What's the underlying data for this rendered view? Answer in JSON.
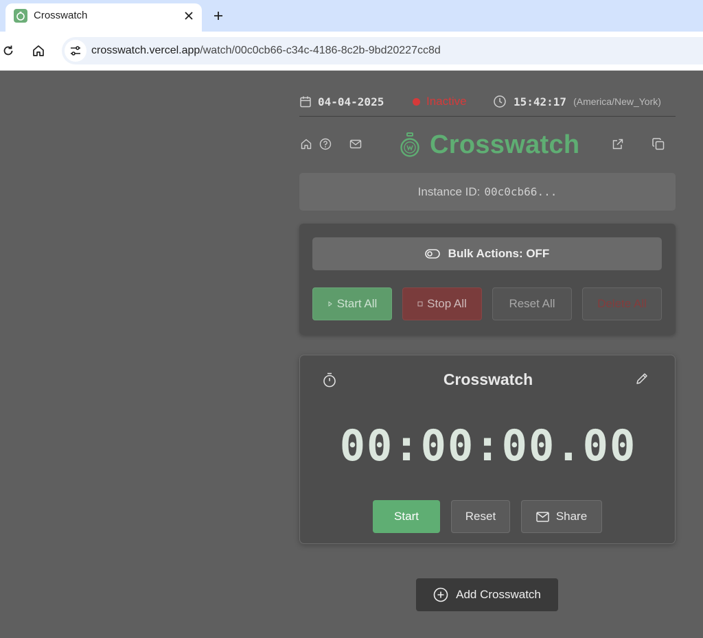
{
  "browser": {
    "tab_title": "Crosswatch",
    "url_host": "crosswatch.vercel.app",
    "url_path": "/watch/00c0cb66-c34c-4186-8c2b-9bd20227cc8d"
  },
  "status": {
    "date": "04-04-2025",
    "state": "Inactive",
    "time": "15:42:17",
    "timezone": "(America/New_York)",
    "state_color": "#d63a3a"
  },
  "header": {
    "brand": "Crosswatch",
    "brand_color": "#5fae73",
    "icons": [
      "home-icon",
      "help-icon",
      "mail-icon",
      "external-link-icon",
      "copy-icon"
    ]
  },
  "instance": {
    "label": "Instance ID:",
    "id": "00c0cb66..."
  },
  "bulk": {
    "toggle_label": "Bulk Actions: OFF",
    "start_all": "Start All",
    "stop_all": "Stop All",
    "reset_all": "Reset All",
    "delete_all": "Delete All"
  },
  "watch": {
    "title": "Crosswatch",
    "time": "00:00:00.00",
    "start": "Start",
    "reset": "Reset",
    "share": "Share"
  },
  "add_button": "Add Crosswatch"
}
